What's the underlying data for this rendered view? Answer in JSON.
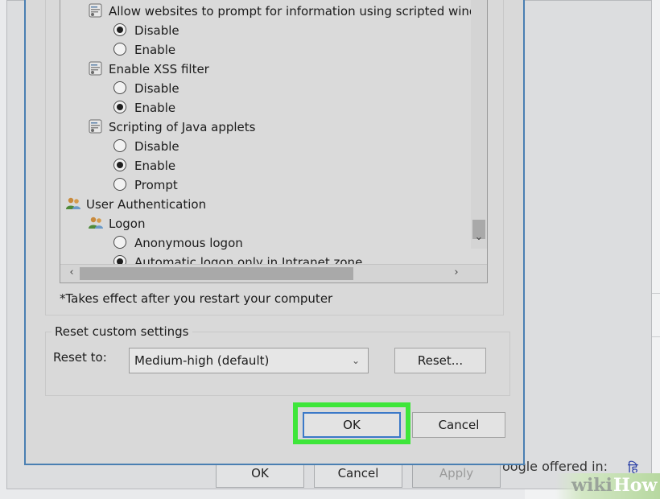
{
  "tree": {
    "rows": [
      {
        "kind": "setting",
        "label": "Allow websites to prompt for information using scripted windc"
      },
      {
        "kind": "option",
        "label": "Disable",
        "selected": true
      },
      {
        "kind": "option",
        "label": "Enable",
        "selected": false
      },
      {
        "kind": "setting",
        "label": "Enable XSS filter"
      },
      {
        "kind": "option",
        "label": "Disable",
        "selected": false
      },
      {
        "kind": "option",
        "label": "Enable",
        "selected": true
      },
      {
        "kind": "setting",
        "label": "Scripting of Java applets"
      },
      {
        "kind": "option",
        "label": "Disable",
        "selected": false
      },
      {
        "kind": "option",
        "label": "Enable",
        "selected": true
      },
      {
        "kind": "option",
        "label": "Prompt",
        "selected": false
      },
      {
        "kind": "category",
        "label": "User Authentication"
      },
      {
        "kind": "category",
        "label": "Logon"
      },
      {
        "kind": "option",
        "label": "Anonymous logon",
        "selected": false
      },
      {
        "kind": "option",
        "label": "Automatic logon only in Intranet zone",
        "selected": true
      }
    ]
  },
  "note": "*Takes effect after you restart your computer",
  "reset": {
    "group_label": "Reset custom settings",
    "reset_to_label": "Reset to:",
    "selected_level": "Medium-high (default)",
    "reset_button": "Reset..."
  },
  "dialog": {
    "ok_button": "OK",
    "cancel_button": "Cancel"
  },
  "parent": {
    "ok_button": "OK",
    "cancel_button": "Cancel",
    "apply_button": "Apply"
  },
  "background": {
    "text": "oogle offered in:",
    "link": "हि"
  },
  "watermark": {
    "wiki": "wiki",
    "how": "How"
  },
  "colors": {
    "highlight": "#3ee63a",
    "dialog_border": "#4a7fb2",
    "default_button_border": "#3b79c8"
  }
}
